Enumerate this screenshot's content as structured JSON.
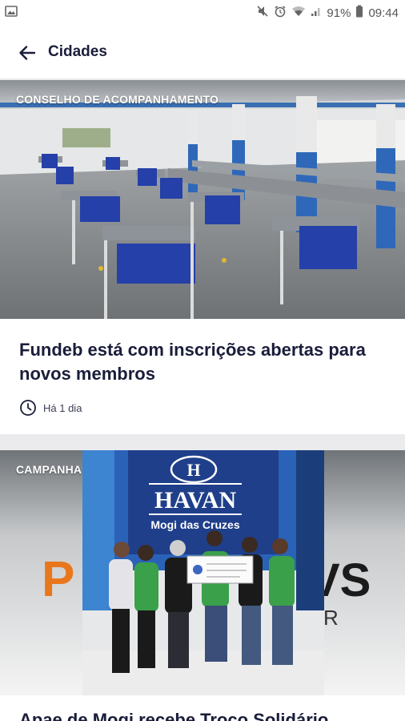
{
  "status_bar": {
    "battery_percent": "91%",
    "time": "09:44",
    "icons": [
      "gallery-icon",
      "mute-icon",
      "alarm-icon",
      "wifi-icon",
      "signal-icon",
      "battery-icon"
    ]
  },
  "app_bar": {
    "back_icon": "arrow-left-icon",
    "title": "Cidades"
  },
  "articles": [
    {
      "tag": "CONSELHO DE ACOMPANHAMENTO",
      "headline": "Fundeb está com inscrições abertas para novos membros",
      "time_ago": "Há 1 dia",
      "image": "school cafeteria with spaced blue chairs and tables"
    },
    {
      "tag": "CAMPANHA",
      "headline": "Apae de Mogi recebe Troco Solidário",
      "image_text": {
        "logo_letter": "H",
        "brand": "HAVAN",
        "location": "Mogi das Cruzes"
      }
    }
  ],
  "colors": {
    "navy": "#1a1d3a",
    "background": "#ebebee",
    "havan_blue": "#1f3f8a",
    "orange": "#e8771b",
    "green_shirt": "#3aa04a"
  }
}
